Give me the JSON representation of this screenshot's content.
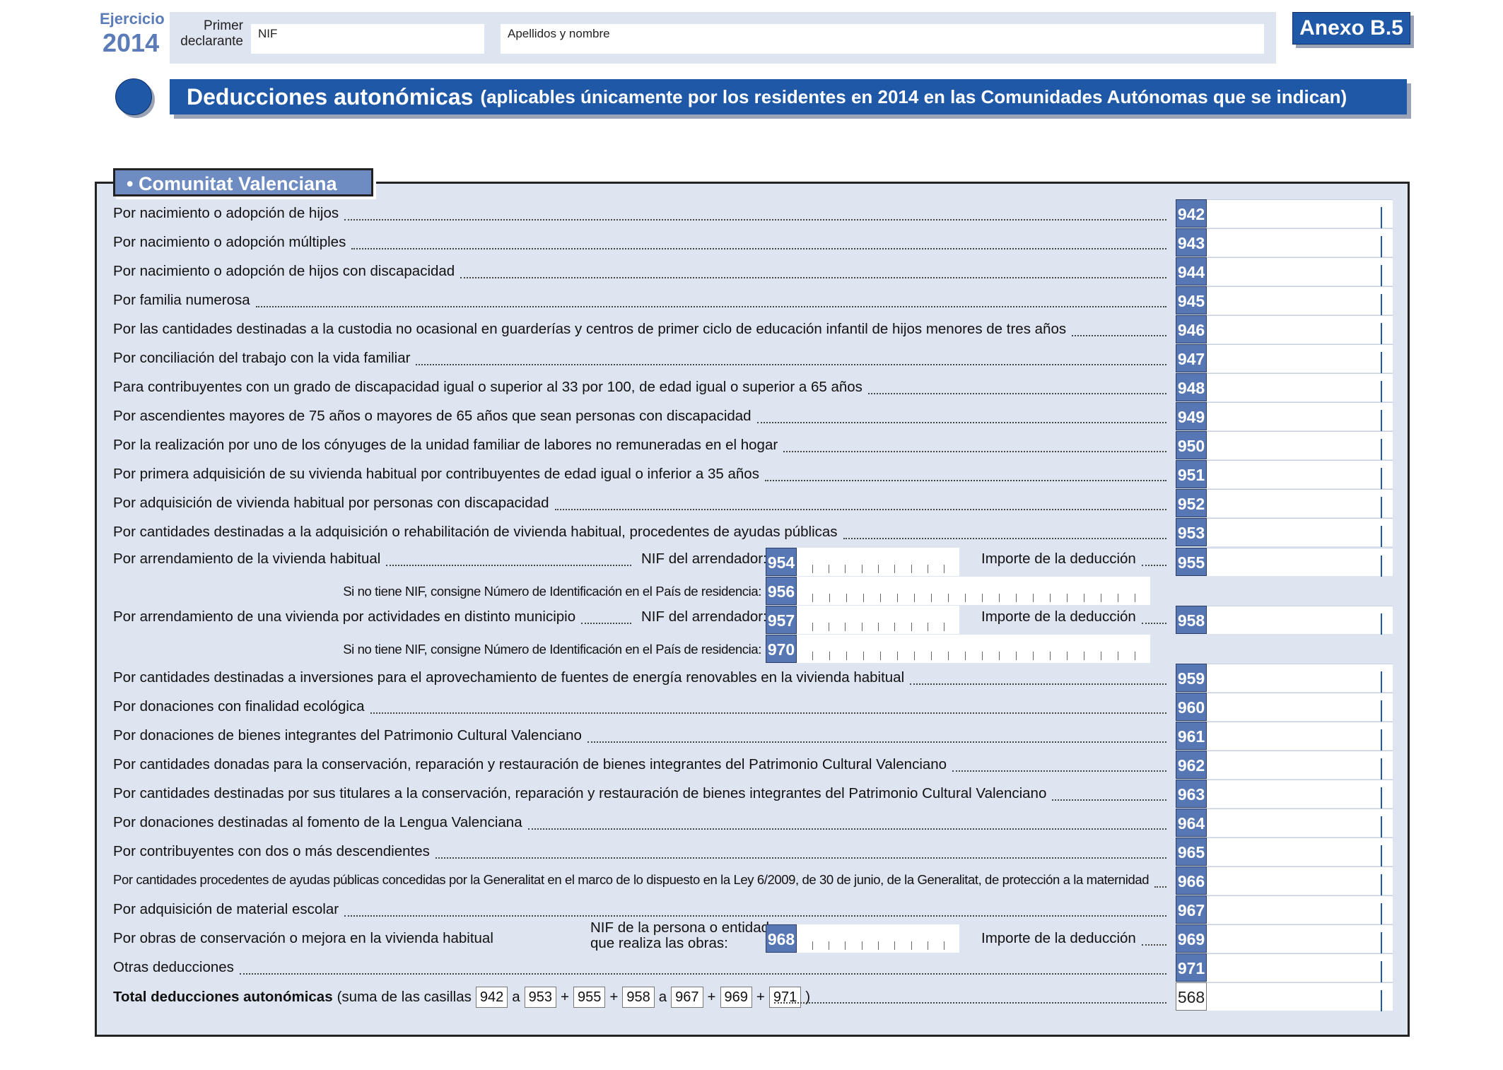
{
  "header": {
    "ejercicio_label": "Ejercicio",
    "ejercicio_year": "2014",
    "primer_declarante": "Primer declarante",
    "nif_label": "NIF",
    "apellidos_label": "Apellidos y nombre",
    "anexo": "Anexo B.5"
  },
  "title": {
    "main": "Deducciones autonómicas",
    "sub": "(aplicables únicamente por los residentes en 2014 en las Comunidades Autónomas que se indican)"
  },
  "section": {
    "name": "•  Comunitat Valenciana"
  },
  "rows": [
    {
      "label": "Por nacimiento o adopción de hijos",
      "code": "942"
    },
    {
      "label": "Por nacimiento o adopción múltiples",
      "code": "943"
    },
    {
      "label": "Por nacimiento o adopción de hijos con discapacidad",
      "code": "944"
    },
    {
      "label": "Por familia numerosa",
      "code": "945"
    },
    {
      "label": "Por las cantidades destinadas a la custodia no ocasional en guarderías y centros de primer ciclo de educación infantil de hijos menores de tres años",
      "code": "946"
    },
    {
      "label": "Por conciliación del trabajo con la vida familiar",
      "code": "947"
    },
    {
      "label": "Para contribuyentes con un grado de discapacidad igual o superior al 33 por 100, de edad igual o superior a 65 años",
      "code": "948"
    },
    {
      "label": "Por ascendientes mayores de 75 años o mayores de 65 años que sean personas con discapacidad",
      "code": "949"
    },
    {
      "label": "Por la realización por uno de los cónyuges de la unidad familiar de labores no remuneradas en el hogar",
      "code": "950"
    },
    {
      "label": "Por primera adquisición de su vivienda habitual por contribuyentes de edad igual o inferior a 35 años",
      "code": "951"
    },
    {
      "label": "Por adquisición de vivienda habitual por personas con discapacidad",
      "code": "952"
    },
    {
      "label": "Por cantidades destinadas a la adquisición o rehabilitación de vivienda habitual, procedentes de ayudas públicas",
      "code": "953"
    }
  ],
  "arrend1": {
    "label": "Por arrendamiento de la vivienda habitual",
    "nif_label": "NIF del arrendador:",
    "nif_code": "954",
    "importe_label": "Importe de la deducción",
    "importe_code": "955",
    "alt_label": "Si no tiene NIF, consigne Número de Identificación en el País de residencia:",
    "alt_code": "956"
  },
  "arrend2": {
    "label": "Por arrendamiento de una vivienda por actividades en distinto municipio",
    "nif_label": "NIF del arrendador:",
    "nif_code": "957",
    "importe_label": "Importe de la deducción",
    "importe_code": "958",
    "alt_label": "Si no tiene NIF, consigne Número de Identificación en el País de residencia:",
    "alt_code": "970"
  },
  "rows2": [
    {
      "label": "Por cantidades destinadas a inversiones para el aprovechamiento de fuentes de energía renovables en la vivienda habitual",
      "code": "959"
    },
    {
      "label": "Por donaciones con finalidad ecológica",
      "code": "960"
    },
    {
      "label": "Por donaciones de bienes integrantes del Patrimonio Cultural Valenciano",
      "code": "961"
    },
    {
      "label": "Por cantidades donadas para la conservación, reparación y restauración de bienes integrantes del Patrimonio Cultural Valenciano",
      "code": "962"
    },
    {
      "label": "Por cantidades destinadas por sus titulares a la conservación, reparación y restauración de bienes integrantes del Patrimonio Cultural Valenciano",
      "code": "963"
    },
    {
      "label": "Por donaciones destinadas al fomento de la Lengua Valenciana",
      "code": "964"
    },
    {
      "label": "Por contribuyentes con dos o más descendientes",
      "code": "965"
    },
    {
      "label": "Por cantidades procedentes de ayudas públicas concedidas por la Generalitat en el marco de lo dispuesto en la Ley 6/2009, de 30 de junio, de la Generalitat, de protección a la maternidad",
      "code": "966"
    },
    {
      "label": "Por adquisición de material escolar",
      "code": "967"
    }
  ],
  "obras": {
    "label": "Por obras de conservación o mejora en la vivienda habitual",
    "nif_label_1": "NIF de la persona o entidad",
    "nif_label_2": "que realiza las obras:",
    "nif_code": "968",
    "importe_label": "Importe de la deducción",
    "importe_code": "969"
  },
  "otras": {
    "label": "Otras deducciones",
    "code": "971"
  },
  "total": {
    "label_bold": "Total deducciones autonómicas",
    "label_pre": "(suma de las casillas",
    "boxes": [
      "942",
      "953",
      "955",
      "958",
      "967",
      "969",
      "971"
    ],
    "ops": [
      "a",
      "+",
      "+",
      "a",
      "+",
      "+"
    ],
    "close": ")",
    "code": "568"
  }
}
